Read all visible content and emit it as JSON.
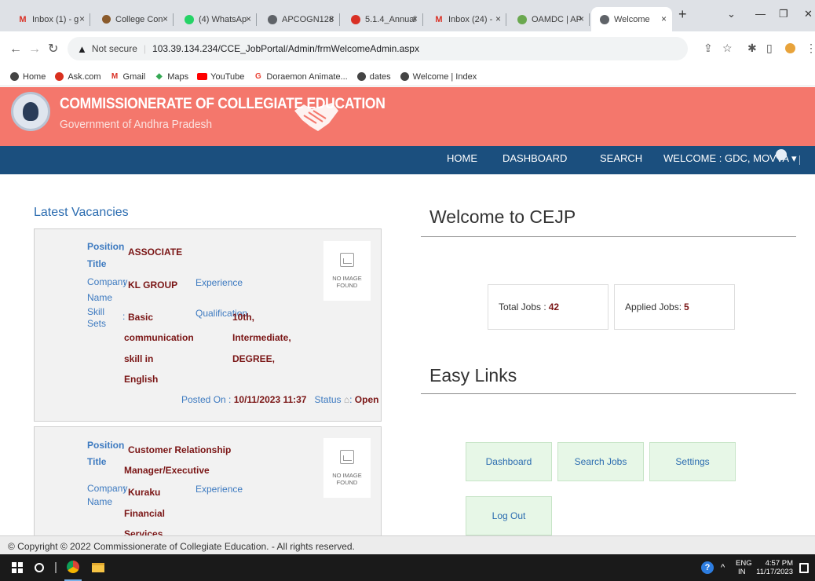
{
  "browser": {
    "tabs": [
      {
        "favicon": "gmail-icon",
        "title": "Inbox (1) - g"
      },
      {
        "favicon": "college-icon",
        "title": "College Con"
      },
      {
        "favicon": "whatsapp-icon",
        "title": "(4) WhatsAp"
      },
      {
        "favicon": "globe-icon",
        "title": "APCOGN128"
      },
      {
        "favicon": "pdf-icon",
        "title": "5.1.4_Annual"
      },
      {
        "favicon": "gmail-icon",
        "title": "Inbox (24) -"
      },
      {
        "favicon": "oamdc-icon",
        "title": "OAMDC | AP"
      },
      {
        "favicon": "globe-icon",
        "title": "Welcome"
      }
    ],
    "address": {
      "security_label": "Not secure",
      "url": "103.39.134.234/CCE_JobPortal/Admin/frmWelcomeAdmin.aspx"
    },
    "bookmarks": [
      {
        "icon": "globe-icon",
        "label": "Home"
      },
      {
        "icon": "askcom-icon",
        "label": "Ask.com"
      },
      {
        "icon": "gmail-icon",
        "label": "Gmail"
      },
      {
        "icon": "maps-icon",
        "label": "Maps"
      },
      {
        "icon": "youtube-icon",
        "label": "YouTube"
      },
      {
        "icon": "google-icon",
        "label": "Doraemon Animate..."
      },
      {
        "icon": "globe-icon",
        "label": "dates"
      },
      {
        "icon": "globe-icon",
        "label": "Welcome | Index"
      }
    ]
  },
  "header": {
    "title": "COMMISSIONERATE OF COLLEGIATE EDUCATION",
    "subtitle": "Government of Andhra Pradesh"
  },
  "nav": {
    "home": "HOME",
    "dashboard": "DASHBOARD",
    "search": "SEARCH",
    "welcome": "WELCOME : GDC, MOVVA ▾"
  },
  "vacancies": {
    "heading": "Latest Vacancies",
    "labels": {
      "position": "Position",
      "title": "Title",
      "company": "Company",
      "name": "Name",
      "skill": "Skill",
      "sets": "Sets",
      "experience": "Experience",
      "qualification": "Qualification",
      "posted_on": "Posted On :",
      "status": "Status",
      "no_image": "NO IMAGE",
      "found": "FOUND"
    },
    "items": [
      {
        "position_lines": [
          "ASSOCIATE"
        ],
        "company_lines": [
          "KL GROUP"
        ],
        "skill_lines": [
          "Basic",
          "communication",
          "skill in",
          "English"
        ],
        "qualification_lines": [
          "10th,",
          "Intermediate,",
          "DEGREE,"
        ],
        "posted_on": "10/11/2023 11:37",
        "status": "Open"
      },
      {
        "position_lines": [
          "Customer Relationship",
          "Manager/Executive"
        ],
        "company_lines": [
          "Kuraku",
          "Financial",
          "Services"
        ]
      }
    ]
  },
  "welcome": {
    "heading": "Welcome to CEJP",
    "total_jobs_label": "Total Jobs :",
    "total_jobs": "42",
    "applied_jobs_label": "Applied Jobs:",
    "applied_jobs": "5"
  },
  "easy_links": {
    "heading": "Easy Links",
    "links": [
      "Dashboard",
      "Search Jobs",
      "Settings",
      "Log Out"
    ]
  },
  "footer": {
    "text": "© Copyright © 2022 Commissionerate of Collegiate Education. - All rights reserved."
  },
  "taskbar": {
    "lang_top": "ENG",
    "lang_bottom": "IN",
    "time": "4:57 PM",
    "date": "11/17/2023"
  },
  "colors": {
    "header_bg": "#f4776c",
    "navbar_bg": "#1b4f7e",
    "label_blue": "#3d7ac0",
    "value_maroon": "#7a1515",
    "link_bg": "#e7f7e7"
  }
}
